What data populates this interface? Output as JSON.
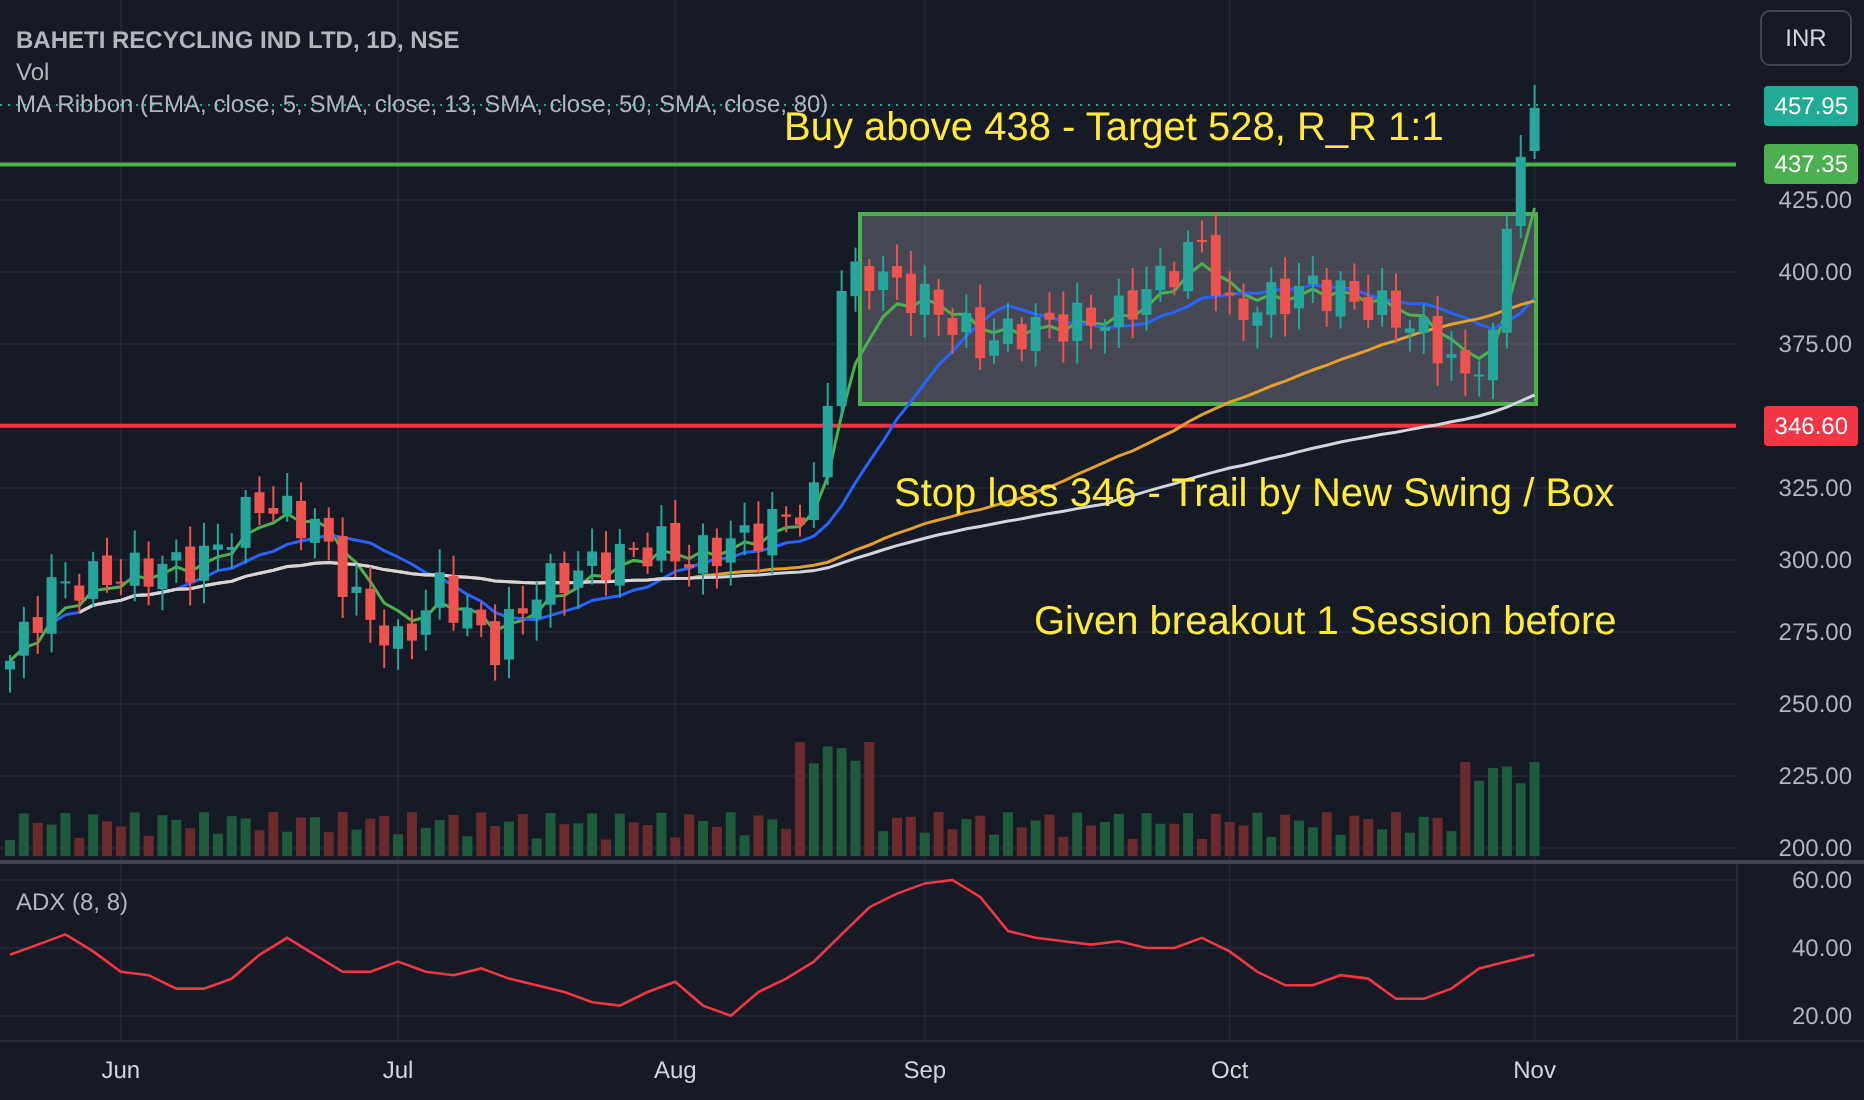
{
  "legend": {
    "symbol": "BAHETI RECYCLING IND LTD, 1D, NSE",
    "volume": "Vol",
    "ma_ribbon": "MA Ribbon (EMA, close, 5, SMA, close, 13, SMA, close, 50, SMA, close, 80)"
  },
  "currency_button": "INR",
  "annotations": [
    "Buy above 438 - Target 528, R_R 1:1",
    "Stop loss 346 - Trail by New Swing / Box",
    "Given breakout 1 Session before"
  ],
  "price_tags": [
    {
      "label": "457.95",
      "kind": "last-price",
      "color": "#22ab94"
    },
    {
      "label": "437.35",
      "kind": "level",
      "color": "#4caf50"
    },
    {
      "label": "346.60",
      "kind": "level",
      "color": "#f23645"
    }
  ],
  "price_axis": [
    "425.00",
    "400.00",
    "375.00",
    "325.00",
    "300.00",
    "275.00",
    "250.00",
    "225.00",
    "200.00"
  ],
  "adx_pane": {
    "chart_data": {
      "type": "line",
      "title": "ADX (8, 8)",
      "categories": [
        null,
        null,
        null,
        null,
        "Jun",
        null,
        null,
        null,
        null,
        null,
        null,
        null,
        null,
        null,
        "Jul",
        null,
        null,
        null,
        null,
        null,
        null,
        null,
        null,
        null,
        "Aug",
        null,
        null,
        null,
        null,
        null,
        null,
        null,
        null,
        "Sep",
        null,
        null,
        null,
        null,
        null,
        null,
        null,
        null,
        null,
        null,
        "Oct",
        null,
        null,
        null,
        null,
        null,
        null,
        null,
        null,
        null,
        null,
        "Nov"
      ],
      "series": [
        {
          "color": "#f23645",
          "values": [
            38,
            41,
            44,
            39,
            33,
            32,
            28,
            28,
            31,
            38,
            43,
            38,
            33,
            33,
            36,
            33,
            32,
            34,
            31,
            29,
            27,
            24,
            23,
            27,
            30,
            23,
            20,
            27,
            31,
            36,
            44,
            52,
            56,
            59,
            60,
            55,
            45,
            43,
            42,
            41,
            42,
            40,
            40,
            43,
            39,
            33,
            29,
            29,
            32,
            31,
            25,
            25,
            28,
            34,
            36,
            38
          ]
        }
      ],
      "grid": true,
      "ylim": [
        12.9,
        64.7
      ],
      "yticks": [
        {
          "value": 60,
          "label": "60.00"
        },
        {
          "value": 40,
          "label": "40.00"
        },
        {
          "value": 20,
          "label": "20.00"
        }
      ]
    }
  }
}
